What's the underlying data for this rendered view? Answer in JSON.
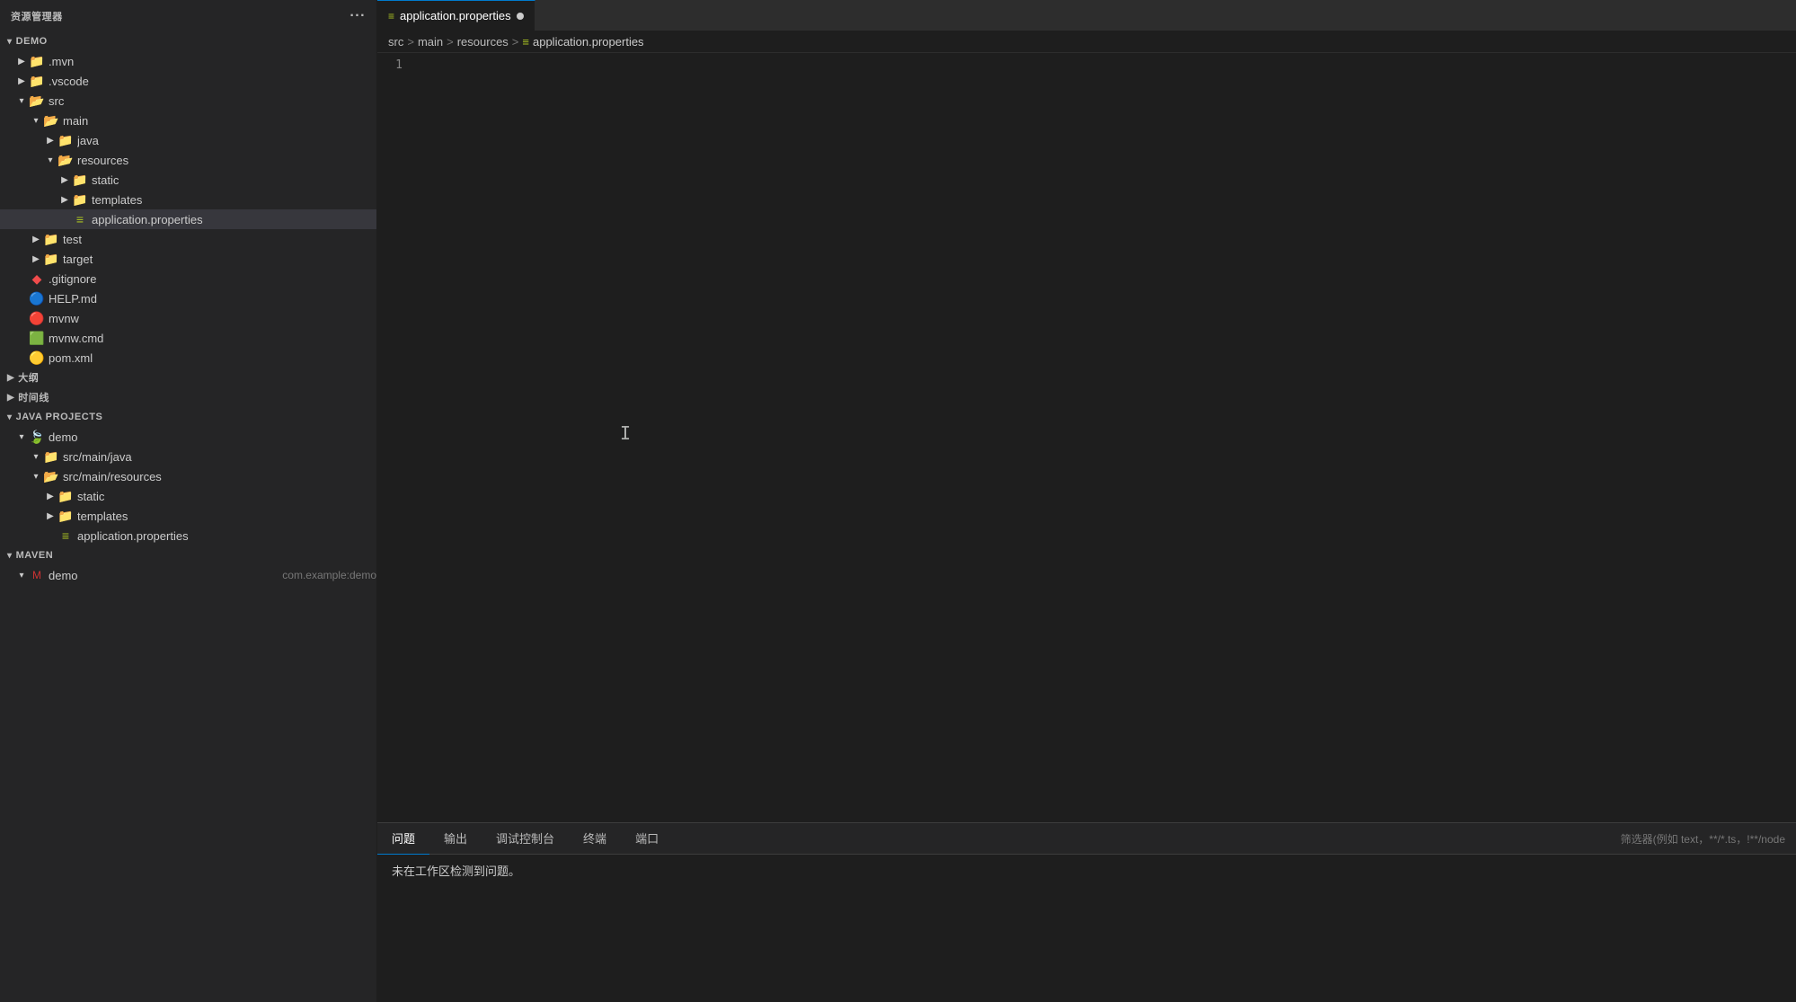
{
  "sidebar": {
    "header": "资源管理器",
    "more_icon": "···",
    "sections": {
      "demo": {
        "label": "DEMO",
        "expanded": true
      },
      "outline": {
        "label": "大纲",
        "expanded": false
      },
      "timeline": {
        "label": "时间线",
        "expanded": false
      },
      "java_projects": {
        "label": "JAVA PROJECTS",
        "expanded": true
      },
      "maven": {
        "label": "MAVEN",
        "expanded": false
      }
    },
    "file_tree": [
      {
        "id": "mvn",
        "label": ".mvn",
        "indent": 1,
        "type": "folder",
        "expanded": false
      },
      {
        "id": "vscode",
        "label": ".vscode",
        "indent": 1,
        "type": "folder",
        "expanded": false
      },
      {
        "id": "src",
        "label": "src",
        "indent": 1,
        "type": "folder",
        "expanded": true
      },
      {
        "id": "main",
        "label": "main",
        "indent": 2,
        "type": "folder",
        "expanded": true
      },
      {
        "id": "java",
        "label": "java",
        "indent": 3,
        "type": "folder",
        "expanded": false
      },
      {
        "id": "resources",
        "label": "resources",
        "indent": 3,
        "type": "folder",
        "expanded": true
      },
      {
        "id": "static",
        "label": "static",
        "indent": 4,
        "type": "folder",
        "expanded": false
      },
      {
        "id": "templates",
        "label": "templates",
        "indent": 4,
        "type": "folder",
        "expanded": false
      },
      {
        "id": "app_props",
        "label": "application.properties",
        "indent": 4,
        "type": "properties",
        "expanded": false,
        "selected": true
      },
      {
        "id": "test",
        "label": "test",
        "indent": 2,
        "type": "folder",
        "expanded": false
      },
      {
        "id": "target",
        "label": "target",
        "indent": 2,
        "type": "folder",
        "expanded": false
      },
      {
        "id": "gitignore",
        "label": ".gitignore",
        "indent": 1,
        "type": "git",
        "expanded": false
      },
      {
        "id": "helpmd",
        "label": "HELP.md",
        "indent": 1,
        "type": "md",
        "expanded": false
      },
      {
        "id": "mvnw",
        "label": "mvnw",
        "indent": 1,
        "type": "mvnw",
        "expanded": false
      },
      {
        "id": "mvnw_cmd",
        "label": "mvnw.cmd",
        "indent": 1,
        "type": "cmd",
        "expanded": false
      },
      {
        "id": "pom",
        "label": "pom.xml",
        "indent": 1,
        "type": "xml",
        "expanded": false
      }
    ],
    "java_projects_tree": [
      {
        "id": "jp_demo",
        "label": "demo",
        "indent": 1,
        "type": "spring",
        "expanded": true
      },
      {
        "id": "jp_src_java",
        "label": "src/main/java",
        "indent": 2,
        "type": "folder",
        "expanded": false
      },
      {
        "id": "jp_src_resources",
        "label": "src/main/resources",
        "indent": 2,
        "type": "folder",
        "expanded": true
      },
      {
        "id": "jp_static",
        "label": "static",
        "indent": 3,
        "type": "folder",
        "expanded": false
      },
      {
        "id": "jp_templates",
        "label": "templates",
        "indent": 3,
        "type": "folder",
        "expanded": false
      },
      {
        "id": "jp_app_props",
        "label": "application.properties",
        "indent": 3,
        "type": "properties",
        "expanded": false,
        "selected": false
      }
    ],
    "maven_section": {
      "label": "MAVEN",
      "demo_label": "demo",
      "com_label": "com.example:demo"
    }
  },
  "editor": {
    "tab_label": "application.properties",
    "tab_modified": true,
    "breadcrumb": {
      "parts": [
        "src",
        "main",
        "resources",
        "application.properties"
      ],
      "separators": [
        ">",
        ">",
        ">"
      ]
    },
    "line_numbers": [
      "1"
    ],
    "content": ""
  },
  "bottom_panel": {
    "tabs": [
      {
        "id": "problems",
        "label": "问题",
        "active": true
      },
      {
        "id": "output",
        "label": "输出",
        "active": false
      },
      {
        "id": "debug",
        "label": "调试控制台",
        "active": false
      },
      {
        "id": "terminal",
        "label": "终端",
        "active": false
      },
      {
        "id": "ports",
        "label": "端口",
        "active": false
      }
    ],
    "filter_placeholder": "筛选器(例如 text，**/*.ts，!**/node",
    "no_problems_text": "未在工作区检测到问题。"
  }
}
